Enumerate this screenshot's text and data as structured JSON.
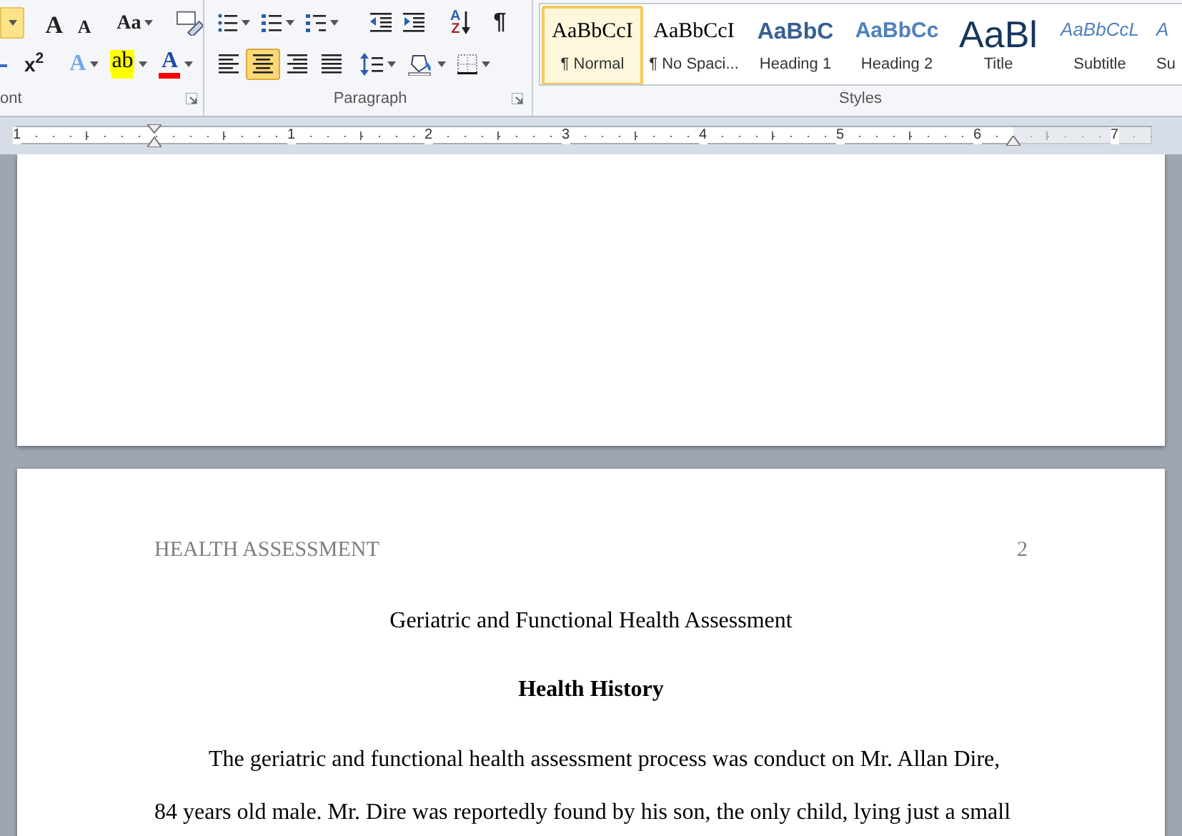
{
  "ribbon": {
    "font_group": {
      "label": "ont",
      "row1": [
        {
          "kind": "size-dropdown",
          "selected": true
        },
        {
          "kind": "grow",
          "glyph": "A"
        },
        {
          "kind": "shrink",
          "glyph": "A"
        },
        {
          "kind": "case",
          "glyph": "Aa"
        },
        {
          "kind": "clear"
        }
      ],
      "row2": [
        {
          "kind": "subscript"
        },
        {
          "kind": "superscript",
          "glyph": "x$^{2}$"
        },
        {
          "kind": "effects",
          "glyph": "A"
        },
        {
          "kind": "highlight",
          "glyph": "ab"
        },
        {
          "kind": "color",
          "glyph": "A"
        }
      ]
    },
    "paragraph_group": {
      "label": "Paragraph",
      "row1": [
        {
          "kind": "bullets"
        },
        {
          "kind": "numbering"
        },
        {
          "kind": "multilevel"
        },
        {
          "kind": "outdent"
        },
        {
          "kind": "indent"
        },
        {
          "kind": "sort",
          "glyph": "A",
          "glyph2": "Z"
        },
        {
          "kind": "pilcrow",
          "glyph": "¶"
        }
      ],
      "row2": [
        {
          "kind": "align-left",
          "selected": false
        },
        {
          "kind": "align-center",
          "selected": true
        },
        {
          "kind": "align-right",
          "selected": false
        },
        {
          "kind": "justify",
          "selected": false
        },
        {
          "kind": "spacing"
        },
        {
          "kind": "shading"
        },
        {
          "kind": "borders"
        }
      ]
    },
    "styles_group": {
      "label": "Styles",
      "styles": [
        {
          "preview": "AaBbCcI",
          "name": "¶ Normal",
          "kind": "normal",
          "selected": true
        },
        {
          "preview": "AaBbCcI",
          "name": "¶ No Spaci...",
          "kind": "normal",
          "selected": false
        },
        {
          "preview": "AaBbC",
          "name": "Heading 1",
          "kind": "heading1",
          "selected": false
        },
        {
          "preview": "AaBbCc",
          "name": "Heading 2",
          "kind": "heading2",
          "selected": false
        },
        {
          "preview": "AaBl",
          "name": "Title",
          "kind": "title",
          "selected": false
        },
        {
          "preview": "AaBbCcL",
          "name": "Subtitle",
          "kind": "subtitle",
          "selected": false
        },
        {
          "preview": "A",
          "name": "Su",
          "kind": "subtitle",
          "selected": false
        }
      ]
    }
  },
  "ruler": {
    "labels": [
      "1",
      "1",
      "2",
      "3",
      "4",
      "5",
      "6",
      "7"
    ]
  },
  "document": {
    "header_left": "HEALTH ASSESSMENT",
    "page_number": "2",
    "title": "Geriatric and Functional Health Assessment",
    "heading": "Health History",
    "paragraph": "The geriatric and functional health assessment process was conduct on Mr. Allan Dire, 84 years old male. Mr. Dire was reportedly found by his son, the only child, lying just a small"
  }
}
